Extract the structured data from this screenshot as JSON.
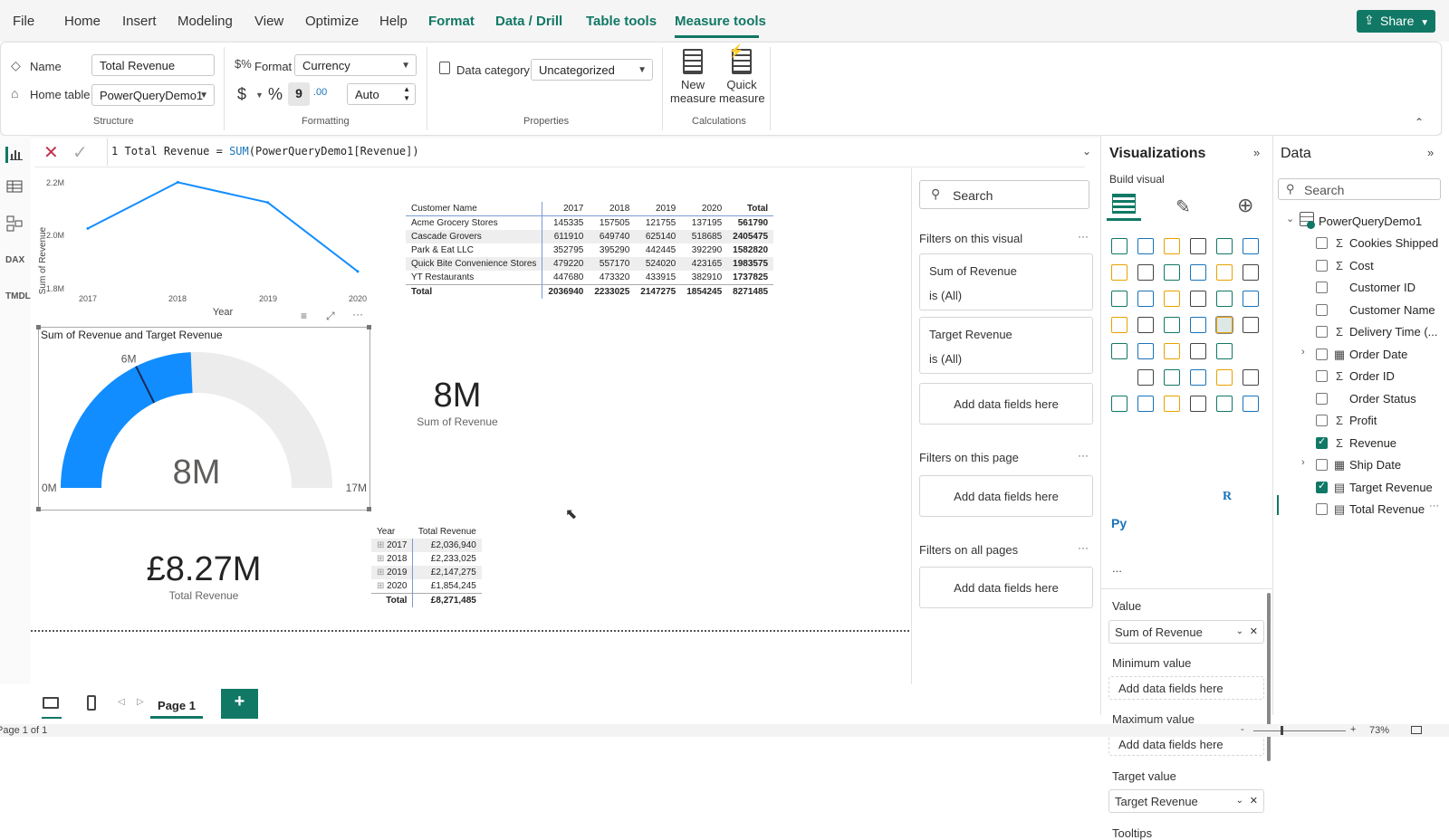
{
  "app": {
    "menu": [
      "File",
      "Home",
      "Insert",
      "Modeling",
      "View",
      "Optimize",
      "Help",
      "Format",
      "Data / Drill",
      "Table tools",
      "Measure tools"
    ],
    "active_menu": "Measure tools",
    "share_label": "Share"
  },
  "ribbon": {
    "name_label": "Name",
    "name_value": "Total Revenue",
    "home_table_label": "Home table",
    "home_table_value": "PowerQueryDemo1",
    "structure_label": "Structure",
    "format_label": "Format",
    "format_value": "Currency",
    "currency_symbol": "$",
    "percent_symbol": "%",
    "comma_symbol": "9",
    "auto_value": "Auto",
    "formatting_label": "Formatting",
    "data_category_label": "Data category",
    "data_category_value": "Uncategorized",
    "properties_label": "Properties",
    "new_measure_line1": "New",
    "new_measure_line2": "measure",
    "quick_measure_line1": "Quick",
    "quick_measure_line2": "measure",
    "calculations_label": "Calculations"
  },
  "leftbar": {
    "dax": "DAX",
    "tmdl": "TMDL"
  },
  "formula": {
    "line_number": "1",
    "text_prefix": "Total Revenue = ",
    "func": "SUM",
    "args": "(PowerQueryDemo1[Revenue])"
  },
  "line_chart": {
    "ylabel": "Sum of Revenue",
    "xlabel": "Year",
    "yticks": [
      "2.2M",
      "2.0M",
      "1.8M"
    ],
    "xticks": [
      "2017",
      "2018",
      "2019",
      "2020"
    ]
  },
  "chart_data": [
    {
      "type": "line",
      "x": [
        2017,
        2018,
        2019,
        2020
      ],
      "series": [
        {
          "values": [
            2036940,
            2233025,
            2147275,
            1854245
          ]
        }
      ],
      "xlabel": "Year",
      "ylabel": "Sum of Revenue",
      "ylim": [
        1800000,
        2250000
      ],
      "color": "#118DFF"
    },
    {
      "type": "gauge",
      "title": "Sum of Revenue and Target Revenue",
      "value": 8271485,
      "min": 0,
      "max": 17000000,
      "target": 6000000,
      "value_label": "8M",
      "min_label": "0M",
      "max_label": "17M",
      "target_label": "6M"
    }
  ],
  "matrix": {
    "headers": [
      "Customer Name",
      "2017",
      "2018",
      "2019",
      "2020",
      "Total"
    ],
    "rows": [
      [
        "Acme Grocery Stores",
        "145335",
        "157505",
        "121755",
        "137195",
        "561790"
      ],
      [
        "Cascade Grovers",
        "611910",
        "649740",
        "625140",
        "518685",
        "2405475"
      ],
      [
        "Park & Eat LLC",
        "352795",
        "395290",
        "442445",
        "392290",
        "1582820"
      ],
      [
        "Quick Bite Convenience Stores",
        "479220",
        "557170",
        "524020",
        "423165",
        "1983575"
      ],
      [
        "YT Restaurants",
        "447680",
        "473320",
        "433915",
        "382910",
        "1737825"
      ]
    ],
    "total": [
      "Total",
      "2036940",
      "2233025",
      "2147275",
      "1854245",
      "8271485"
    ]
  },
  "card_8m": {
    "value": "8M",
    "label": "Sum of Revenue"
  },
  "card_total": {
    "value": "£8.27M",
    "label": "Total Revenue"
  },
  "year_table": {
    "headers": [
      "Year",
      "Total Revenue"
    ],
    "rows": [
      [
        "2017",
        "£2,036,940"
      ],
      [
        "2018",
        "£2,233,025"
      ],
      [
        "2019",
        "£2,147,275"
      ],
      [
        "2020",
        "£1,854,245"
      ]
    ],
    "total": [
      "Total",
      "£8,271,485"
    ]
  },
  "filters": {
    "search_placeholder": "Search",
    "on_visual": "Filters on this visual",
    "card1_title": "Sum of Revenue",
    "card1_sub": "is (All)",
    "card2_title": "Target Revenue",
    "card2_sub": "is (All)",
    "add_fields": "Add data fields here",
    "on_page": "Filters on this page",
    "on_all": "Filters on all pages"
  },
  "viz": {
    "title": "Visualizations",
    "build": "Build visual",
    "value_label": "Value",
    "value_field": "Sum of Revenue",
    "min_label": "Minimum value",
    "max_label": "Maximum value",
    "target_label": "Target value",
    "target_field": "Target Revenue",
    "tooltips_label": "Tooltips",
    "add_fields": "Add data fields here",
    "r_label": "R",
    "py_label": "Py",
    "more": "..."
  },
  "data": {
    "title": "Data",
    "search_placeholder": "Search",
    "table_name": "PowerQueryDemo1",
    "fields": [
      {
        "label": "Cookies Shipped",
        "icon": "Σ",
        "checked": false,
        "expander": false
      },
      {
        "label": "Cost",
        "icon": "Σ",
        "checked": false,
        "expander": false
      },
      {
        "label": "Customer ID",
        "icon": "",
        "checked": false,
        "expander": false
      },
      {
        "label": "Customer Name",
        "icon": "",
        "checked": false,
        "expander": false
      },
      {
        "label": "Delivery Time (...",
        "icon": "Σ",
        "checked": false,
        "expander": false
      },
      {
        "label": "Order Date",
        "icon": "▦",
        "checked": false,
        "expander": true
      },
      {
        "label": "Order ID",
        "icon": "Σ",
        "checked": false,
        "expander": false
      },
      {
        "label": "Order Status",
        "icon": "",
        "checked": false,
        "expander": false
      },
      {
        "label": "Profit",
        "icon": "Σ",
        "checked": false,
        "expander": false
      },
      {
        "label": "Revenue",
        "icon": "Σ",
        "checked": true,
        "expander": false
      },
      {
        "label": "Ship Date",
        "icon": "▦",
        "checked": false,
        "expander": true
      },
      {
        "label": "Target Revenue",
        "icon": "▤",
        "checked": true,
        "expander": false
      },
      {
        "label": "Total Revenue",
        "icon": "▤",
        "checked": false,
        "expander": false
      }
    ]
  },
  "pages": {
    "tab": "Page 1",
    "add": "+"
  },
  "status": {
    "page": "Page 1 of 1",
    "zoom": "73%",
    "minus": "-",
    "plus": "+"
  }
}
